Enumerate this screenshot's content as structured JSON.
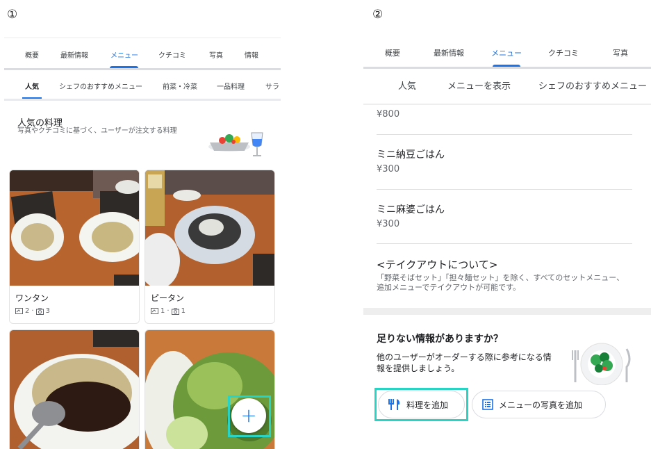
{
  "markers": {
    "panel1": "①",
    "panel2": "②"
  },
  "panel1": {
    "tabs": [
      "概要",
      "最新情報",
      "メニュー",
      "クチコミ",
      "写真",
      "情報"
    ],
    "subtabs": [
      "人気",
      "シェフのおすすめメニュー",
      "前菜・冷菜",
      "一品料理",
      "サラ"
    ],
    "section": {
      "title": "人気の料理",
      "subtitle": "写真やクチコミに基づく、ユーザーが注文する料理"
    },
    "cards": [
      {
        "name": "ワンタン",
        "reviews": "2",
        "photos": "3"
      },
      {
        "name": "ピータン",
        "reviews": "1",
        "photos": "1"
      }
    ],
    "fab_label": "+"
  },
  "panel2": {
    "tabs": [
      "概要",
      "最新情報",
      "メニュー",
      "クチコミ",
      "写真"
    ],
    "subtabs": [
      "人気",
      "メニューを表示",
      "シェフのおすすめメニュー"
    ],
    "partial_price": "¥800",
    "items": [
      {
        "name": "ミニ納豆ごはん",
        "price": "¥300"
      },
      {
        "name": "ミニ麻婆ごはん",
        "price": "¥300"
      }
    ],
    "takeout": {
      "title": "<テイクアウトについて>",
      "body": "「野菜そばセット」「担々麺セット」を除く、すべてのセットメニュー、追加メニューでテイクアウトが可能です。"
    },
    "missing": {
      "title": "足りない情報がありますか？",
      "body": "他のユーザーがオーダーする際に参考になる情報を提供しましょう。",
      "add_dish_label": "料理を追加",
      "add_menu_photo_label": "メニューの写真を追加"
    }
  },
  "colors": {
    "accent": "#1a73e8",
    "highlight": "#2ad4c4"
  }
}
